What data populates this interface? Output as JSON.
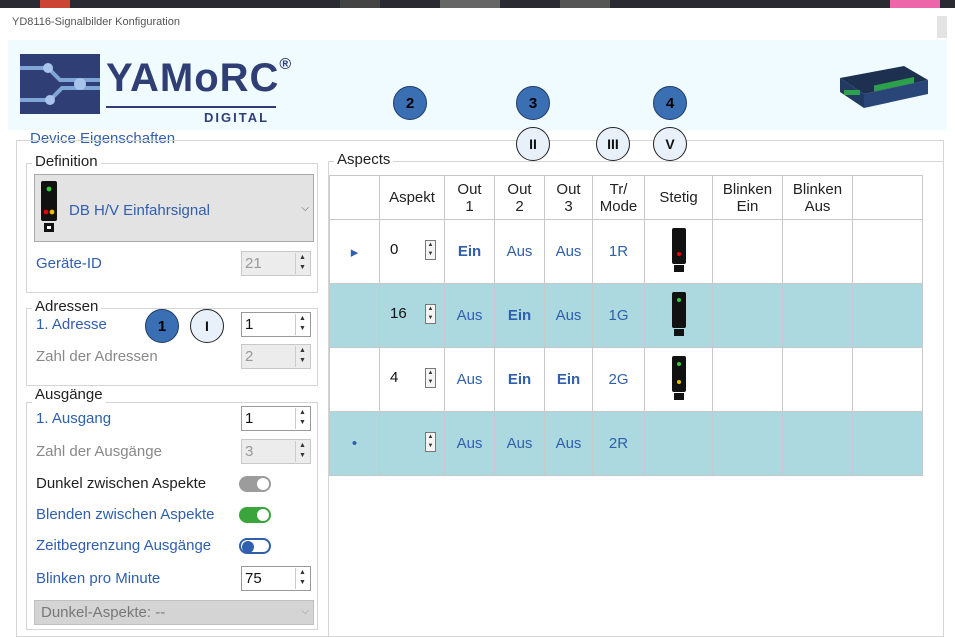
{
  "window": {
    "title": "YD8116-Signalbilder Konfiguration"
  },
  "brand": {
    "name": "YAMoRC",
    "mark": "®",
    "sub": "DIGITAL"
  },
  "colors": {
    "accent": "#2f5fad",
    "row_highlight": "#abd9df",
    "toggle_on": "#3aa53a"
  },
  "badges": {
    "n1": "1",
    "n2": "2",
    "n3": "3",
    "n4": "4",
    "r1": "I",
    "r2": "II",
    "r3": "III",
    "r5": "V"
  },
  "device_props": {
    "title": "Device Eigenschaften"
  },
  "definition": {
    "title": "Definition",
    "selected": "DB H/V Einfahrsignal",
    "geraete_id_label": "Geräte-ID",
    "geraete_id": "21"
  },
  "adressen": {
    "title": "Adressen",
    "first_label": "1. Adresse",
    "first_value": "1",
    "count_label": "Zahl der Adressen",
    "count_value": "2"
  },
  "ausgaenge": {
    "title": "Ausgänge",
    "first_label": "1. Ausgang",
    "first_value": "1",
    "count_label": "Zahl der Ausgänge",
    "count_value": "3",
    "dunkel_label": "Dunkel zwischen Aspekte",
    "dunkel_state": "off",
    "blenden_label": "Blenden zwischen Aspekte",
    "blenden_state": "on",
    "zeit_label": "Zeitbegrenzung Ausgänge",
    "zeit_state": "off",
    "blinken_label": "Blinken pro Minute",
    "blinken_value": "75",
    "dunkel_aspekte": "Dunkel-Aspekte: --"
  },
  "aspects": {
    "title": "Aspects",
    "headers": {
      "aspekt": "Aspekt",
      "out1a": "Out",
      "out1b": "1",
      "out2a": "Out",
      "out2b": "2",
      "out3a": "Out",
      "out3b": "3",
      "tra": "Tr/",
      "trb": "Mode",
      "stetig": "Stetig",
      "bea": "Blinken",
      "beb": "Ein",
      "baa": "Blinken",
      "bab": "Aus"
    },
    "rows": [
      {
        "marker": "▸",
        "aspekt": "0",
        "out1": "Ein",
        "out2": "Aus",
        "out3": "Aus",
        "mode": "1R",
        "signal": "red"
      },
      {
        "marker": "",
        "aspekt": "16",
        "out1": "Aus",
        "out2": "Ein",
        "out3": "Aus",
        "mode": "1G",
        "signal": "green"
      },
      {
        "marker": "",
        "aspekt": "4",
        "out1": "Aus",
        "out2": "Ein",
        "out3": "Ein",
        "mode": "2G",
        "signal": "green-yellow"
      },
      {
        "marker": "•",
        "aspekt": "",
        "out1": "Aus",
        "out2": "Aus",
        "out3": "Aus",
        "mode": "2R",
        "signal": ""
      }
    ]
  }
}
